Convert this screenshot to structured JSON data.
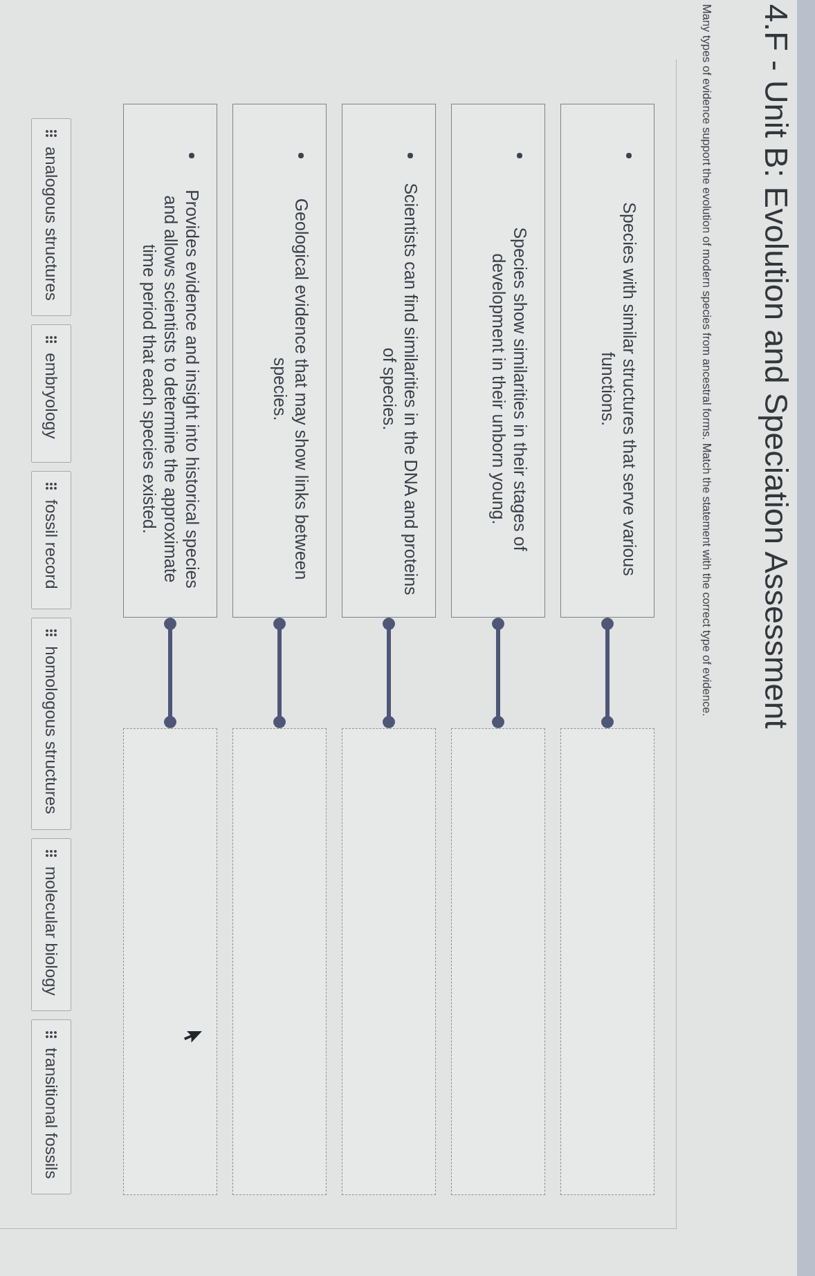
{
  "title": "4.F - Unit B: Evolution and Speciation Assessment",
  "instructions": "Many types of evidence support the evolution of modern species from ancestral forms. Match the statement with the correct type of evidence.",
  "matches": [
    {
      "statement": "Species with similar structures that serve various\nfunctions."
    },
    {
      "statement": "Species show similarities in their stages of\ndevelopment in their unborn young."
    },
    {
      "statement": "Scientists can find similarities in the DNA and proteins\nof species."
    },
    {
      "statement": "Geological evidence that may show links between\nspecies."
    },
    {
      "statement": "Provides evidence and insight into historical species\nand allows scientists to determine the approximate\ntime period that each species existed."
    }
  ],
  "answer_choices": [
    "analogous structures",
    "embryology",
    "fossil record",
    "homologous structures",
    "molecular biology",
    "transitional fossils"
  ]
}
